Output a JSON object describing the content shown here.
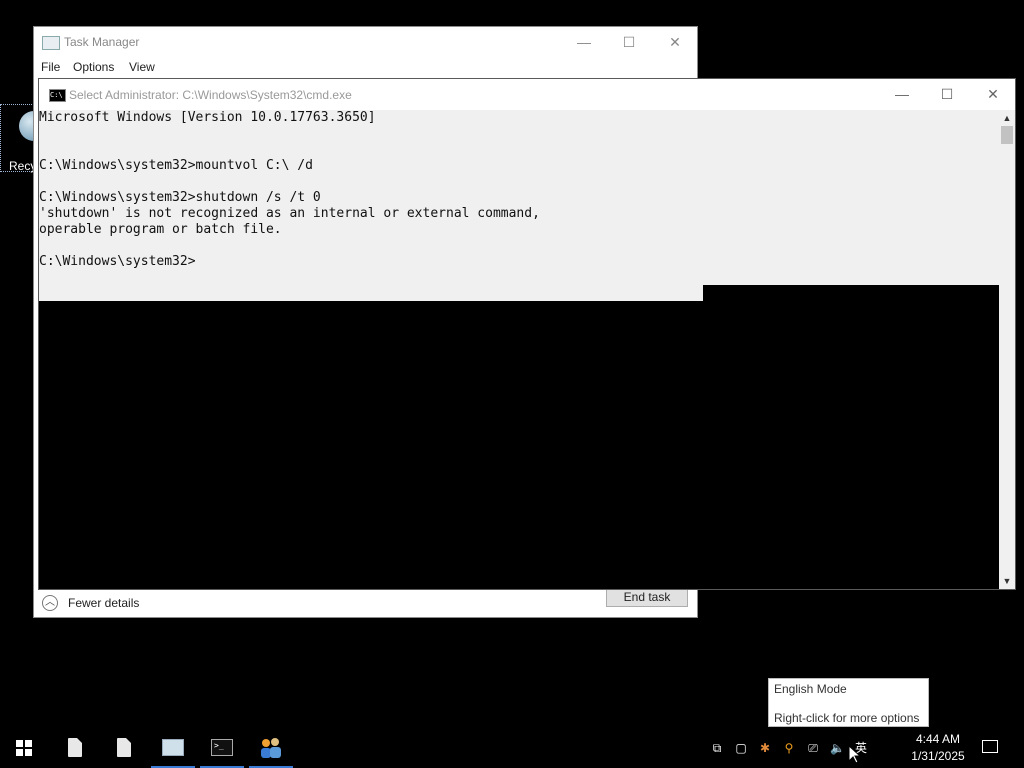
{
  "desktop": {
    "icons": [
      {
        "label": "Recy"
      }
    ]
  },
  "task_manager": {
    "title": "Task Manager",
    "menu": [
      "File",
      "Options",
      "View"
    ],
    "fewer_details": "Fewer details",
    "end_task": "End task",
    "caption": {
      "minimize": "—",
      "maximize": "☐",
      "close": "✕"
    }
  },
  "cmd": {
    "title": "Select Administrator: C:\\Windows\\System32\\cmd.exe",
    "icon_text": "C:\\",
    "lines": [
      "Microsoft Windows [Version 10.0.17763.3650]",
      "",
      "",
      "C:\\Windows\\system32>mountvol C:\\ /d",
      "",
      "C:\\Windows\\system32>shutdown /s /t 0",
      "'shutdown' is not recognized as an internal or external command,",
      "operable program or batch file.",
      "",
      "C:\\Windows\\system32>"
    ],
    "caption": {
      "minimize": "—",
      "maximize": "☐",
      "close": "✕"
    },
    "scroll": {
      "up": "▲",
      "down": "▼"
    }
  },
  "ime_tooltip": {
    "line1": "English Mode",
    "line2": "Right-click for more options"
  },
  "taskbar": {
    "apps": [
      {
        "name": "start",
        "icon": "windows-logo-icon"
      },
      {
        "name": "file1",
        "icon": "document-icon"
      },
      {
        "name": "file2",
        "icon": "document-icon"
      },
      {
        "name": "task-manager",
        "icon": "task-manager-icon",
        "active": true
      },
      {
        "name": "cmd",
        "icon": "command-prompt-icon",
        "active": true
      },
      {
        "name": "people",
        "icon": "people-icon",
        "active": true
      }
    ],
    "tray": {
      "ime": "英",
      "time": "4:44 AM",
      "date": "1/31/2025"
    }
  },
  "colors": {
    "cmd_selection_bg": "#f0f0f0",
    "taskbar_active": "#3a7bd5"
  }
}
